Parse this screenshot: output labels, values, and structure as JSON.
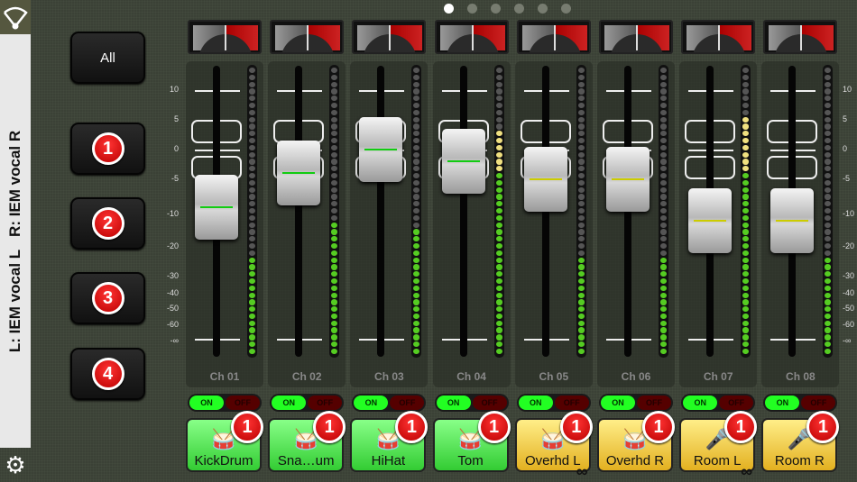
{
  "sidebar": {
    "monitor_label": "L: IEM vocal L   R: IEM vocal R",
    "wifi_icon": "wifi-icon",
    "settings_icon": "gear-icon"
  },
  "groups": {
    "all_label": "All",
    "buttons": [
      "1",
      "2",
      "3",
      "4"
    ]
  },
  "pages": {
    "count": 6,
    "current": 1
  },
  "scale": [
    "10",
    "5",
    "0",
    "-5",
    "-10",
    "-20",
    "-30",
    "-40",
    "-50",
    "-60",
    "-∞"
  ],
  "colors": {
    "green": "#55e055",
    "yellow": "#f5d240",
    "badge": "#cc0000"
  },
  "channels": [
    {
      "name": "Ch 01",
      "label": "KickDrum",
      "icon": "kick-drum-icon",
      "color": "green",
      "db": -9,
      "meter": 0.35,
      "on": "ON",
      "off": "OFF",
      "badge": "1",
      "linked": false
    },
    {
      "name": "Ch 02",
      "label": "Sna…um",
      "icon": "snare-drum-icon",
      "color": "green",
      "db": -4,
      "meter": 0.47,
      "on": "ON",
      "off": "OFF",
      "badge": "1",
      "linked": false
    },
    {
      "name": "Ch 03",
      "label": "HiHat",
      "icon": "hihat-icon",
      "color": "green",
      "db": 0,
      "meter": 0.45,
      "on": "ON",
      "off": "OFF",
      "badge": "1",
      "linked": false
    },
    {
      "name": "Ch 04",
      "label": "Tom",
      "icon": "tom-drum-icon",
      "color": "green",
      "db": -2,
      "meter": 0.78,
      "on": "ON",
      "off": "OFF",
      "badge": "1",
      "linked": false
    },
    {
      "name": "Ch 05",
      "label": "Overhd L",
      "icon": "drum-kit-icon",
      "color": "yellow",
      "db": -5,
      "meter": 0.35,
      "on": "ON",
      "off": "OFF",
      "badge": "1",
      "linked": true
    },
    {
      "name": "Ch 06",
      "label": "Overhd R",
      "icon": "drum-kit-icon",
      "color": "yellow",
      "db": -5,
      "meter": 0.35,
      "on": "ON",
      "off": "OFF",
      "badge": "1",
      "linked": false
    },
    {
      "name": "Ch 07",
      "label": "Room L",
      "icon": "microphone-icon",
      "color": "yellow",
      "db": -12,
      "meter": 0.82,
      "on": "ON",
      "off": "OFF",
      "badge": "1",
      "linked": true
    },
    {
      "name": "Ch 08",
      "label": "Room R",
      "icon": "microphone-icon",
      "color": "yellow",
      "db": -12,
      "meter": 0.35,
      "on": "ON",
      "off": "OFF",
      "badge": "1",
      "linked": false
    }
  ],
  "link_icon": "link-icon"
}
